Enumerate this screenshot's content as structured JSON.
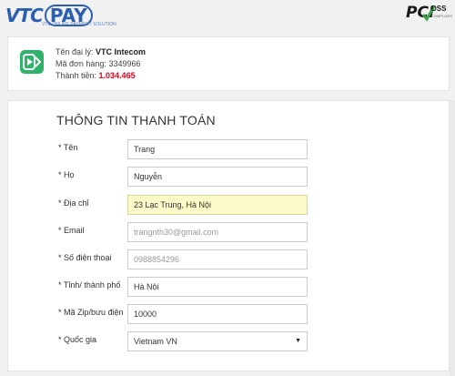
{
  "header": {
    "logo_vtc": "VTC",
    "logo_pay": "PAY",
    "logo_sub": "VTC ONLINE PAYMENT SOLUTION",
    "pci_text": "PCI",
    "pci_dss": "DSS",
    "pci_sub": "COMPLIANT"
  },
  "order": {
    "agent_label": "Tên đại lý:",
    "agent_value": "VTC Intecom",
    "order_id_label": "Mã đơn hàng:",
    "order_id_value": "3349966",
    "total_label": "Thành tiền:",
    "total_value": "1.034.465"
  },
  "form": {
    "title": "THÔNG TIN THANH TOÁN",
    "fields": [
      {
        "label": "* Tên",
        "value": "Trang"
      },
      {
        "label": "* Họ",
        "value": "Nguyễn"
      },
      {
        "label": "* Địa chỉ",
        "value": "23 Lạc Trung, Hà Nội"
      },
      {
        "label": "* Email",
        "value": "trangnth30@gmail.com"
      },
      {
        "label": "* Số điện thoại",
        "value": "0988854296"
      },
      {
        "label": "* Tỉnh/ thành phố",
        "value": "Hà Nội"
      },
      {
        "label": "* Mã Zip/bưu điện",
        "value": "10000"
      },
      {
        "label": "* Quốc gia",
        "value": "Vietnam VN"
      }
    ]
  },
  "colors": {
    "brand_blue": "#2a5fb0",
    "accent_green": "#2db36a",
    "amount_red": "#e4001b",
    "autofill_yellow": "#fcf9c8"
  }
}
